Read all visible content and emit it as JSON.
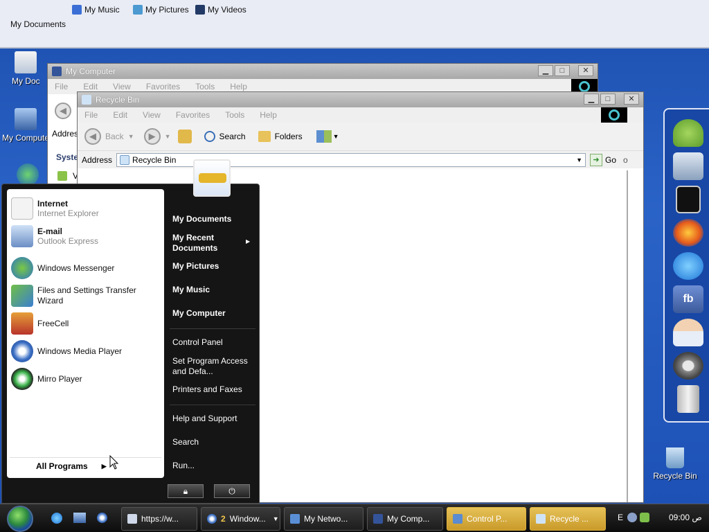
{
  "topbar": {
    "my_music": "My Music",
    "my_pictures": "My Pictures",
    "my_videos": "My Videos",
    "my_documents": "My Documents"
  },
  "desktop_icons": {
    "my_documents": "My Documents",
    "my_computer": "My Computer",
    "recycle_bin": "Recycle Bin"
  },
  "my_computer_window": {
    "title": "My Computer",
    "menu": [
      "File",
      "Edit",
      "View",
      "Favorites",
      "Tools",
      "Help"
    ],
    "addr_label": "Addres",
    "section": "Syste",
    "item_v": "V"
  },
  "recycle_window": {
    "title": "Recycle Bin",
    "menu": [
      "File",
      "Edit",
      "View",
      "Favorites",
      "Tools",
      "Help"
    ],
    "back": "Back",
    "search": "Search",
    "folders": "Folders",
    "address_label": "Address",
    "address_value": "Recycle Bin",
    "go": "Go",
    "go_suffix": "o"
  },
  "start_menu": {
    "pinned": [
      {
        "title": "Internet",
        "sub": "Internet Explorer"
      },
      {
        "title": "E-mail",
        "sub": "Outlook Express"
      }
    ],
    "recent": [
      "Windows Messenger",
      "Files and Settings Transfer Wizard",
      "FreeCell",
      "Windows Media Player",
      "Mirro Player"
    ],
    "all_programs": "All Programs",
    "right_bold": [
      "My Documents",
      "My Recent Documents",
      "My Pictures",
      "My Music",
      "My Computer"
    ],
    "right_group2": [
      "Control Panel",
      "Set Program Access and Defa...",
      "Printers and Faxes"
    ],
    "right_group3": [
      "Help and Support",
      "Search",
      "Run..."
    ]
  },
  "taskbar": {
    "buttons": [
      {
        "label": "https://w...",
        "active": false
      },
      {
        "label": "Window...",
        "count": "2",
        "active": false
      },
      {
        "label": "My Netwo...",
        "active": false
      },
      {
        "label": "My Comp...",
        "active": false
      },
      {
        "label": "Control P...",
        "active": true
      },
      {
        "label": "Recycle ...",
        "active": true
      }
    ],
    "lang": "E",
    "clock": "09:00 ص"
  },
  "colors": {
    "desktop": "#2a63c7",
    "taskbar": "#1a1a1a",
    "active_task": "#d8aa3a",
    "start_menu": "#151515"
  }
}
